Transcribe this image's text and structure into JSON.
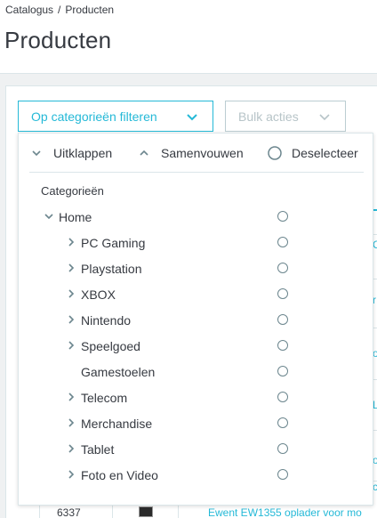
{
  "breadcrumb": {
    "parent": "Catalogus",
    "separator": "/",
    "current": "Producten"
  },
  "page_title": "Producten",
  "toolbar": {
    "filter_button_label": "Op categorieën filteren",
    "bulk_button_label": "Bulk acties"
  },
  "dropdown": {
    "actions": {
      "expand_label": "Uitklappen",
      "collapse_label": "Samenvouwen",
      "deselect_label": "Deselecteer"
    },
    "categories_heading": "Categorieën",
    "tree": {
      "root": {
        "label": "Home",
        "expanded": true,
        "selected": false
      },
      "children": [
        {
          "label": "PC Gaming",
          "has_children": true,
          "selected": false
        },
        {
          "label": "Playstation",
          "has_children": true,
          "selected": false
        },
        {
          "label": "XBOX",
          "has_children": true,
          "selected": false
        },
        {
          "label": "Nintendo",
          "has_children": true,
          "selected": false
        },
        {
          "label": "Speelgoed",
          "has_children": true,
          "selected": false
        },
        {
          "label": "Gamestoelen",
          "has_children": false,
          "selected": false
        },
        {
          "label": "Telecom",
          "has_children": true,
          "selected": false
        },
        {
          "label": "Merchandise",
          "has_children": true,
          "selected": false
        },
        {
          "label": "Tablet",
          "has_children": true,
          "selected": false
        },
        {
          "label": "Foto en Video",
          "has_children": true,
          "selected": false
        }
      ]
    }
  },
  "table": {
    "visible_row": {
      "id": "6337",
      "name": "Ewent EW1355 oplader voor mo"
    },
    "clipped_link_fragments": [
      "C",
      "r",
      "o",
      "L",
      "o",
      "c"
    ]
  },
  "colors": {
    "accent": "#25b9d7",
    "text": "#363a41",
    "border": "#dbe6e9",
    "muted": "#b7c4c8",
    "page_bg": "#eff1f2"
  },
  "icons": {
    "filter_chevron": "chevron-down-icon",
    "expand": "chevron-down-icon",
    "collapse": "chevron-up-icon",
    "deselect": "radio-circle-icon",
    "tree_expanded": "caret-down-icon",
    "tree_collapsed": "caret-right-icon"
  }
}
